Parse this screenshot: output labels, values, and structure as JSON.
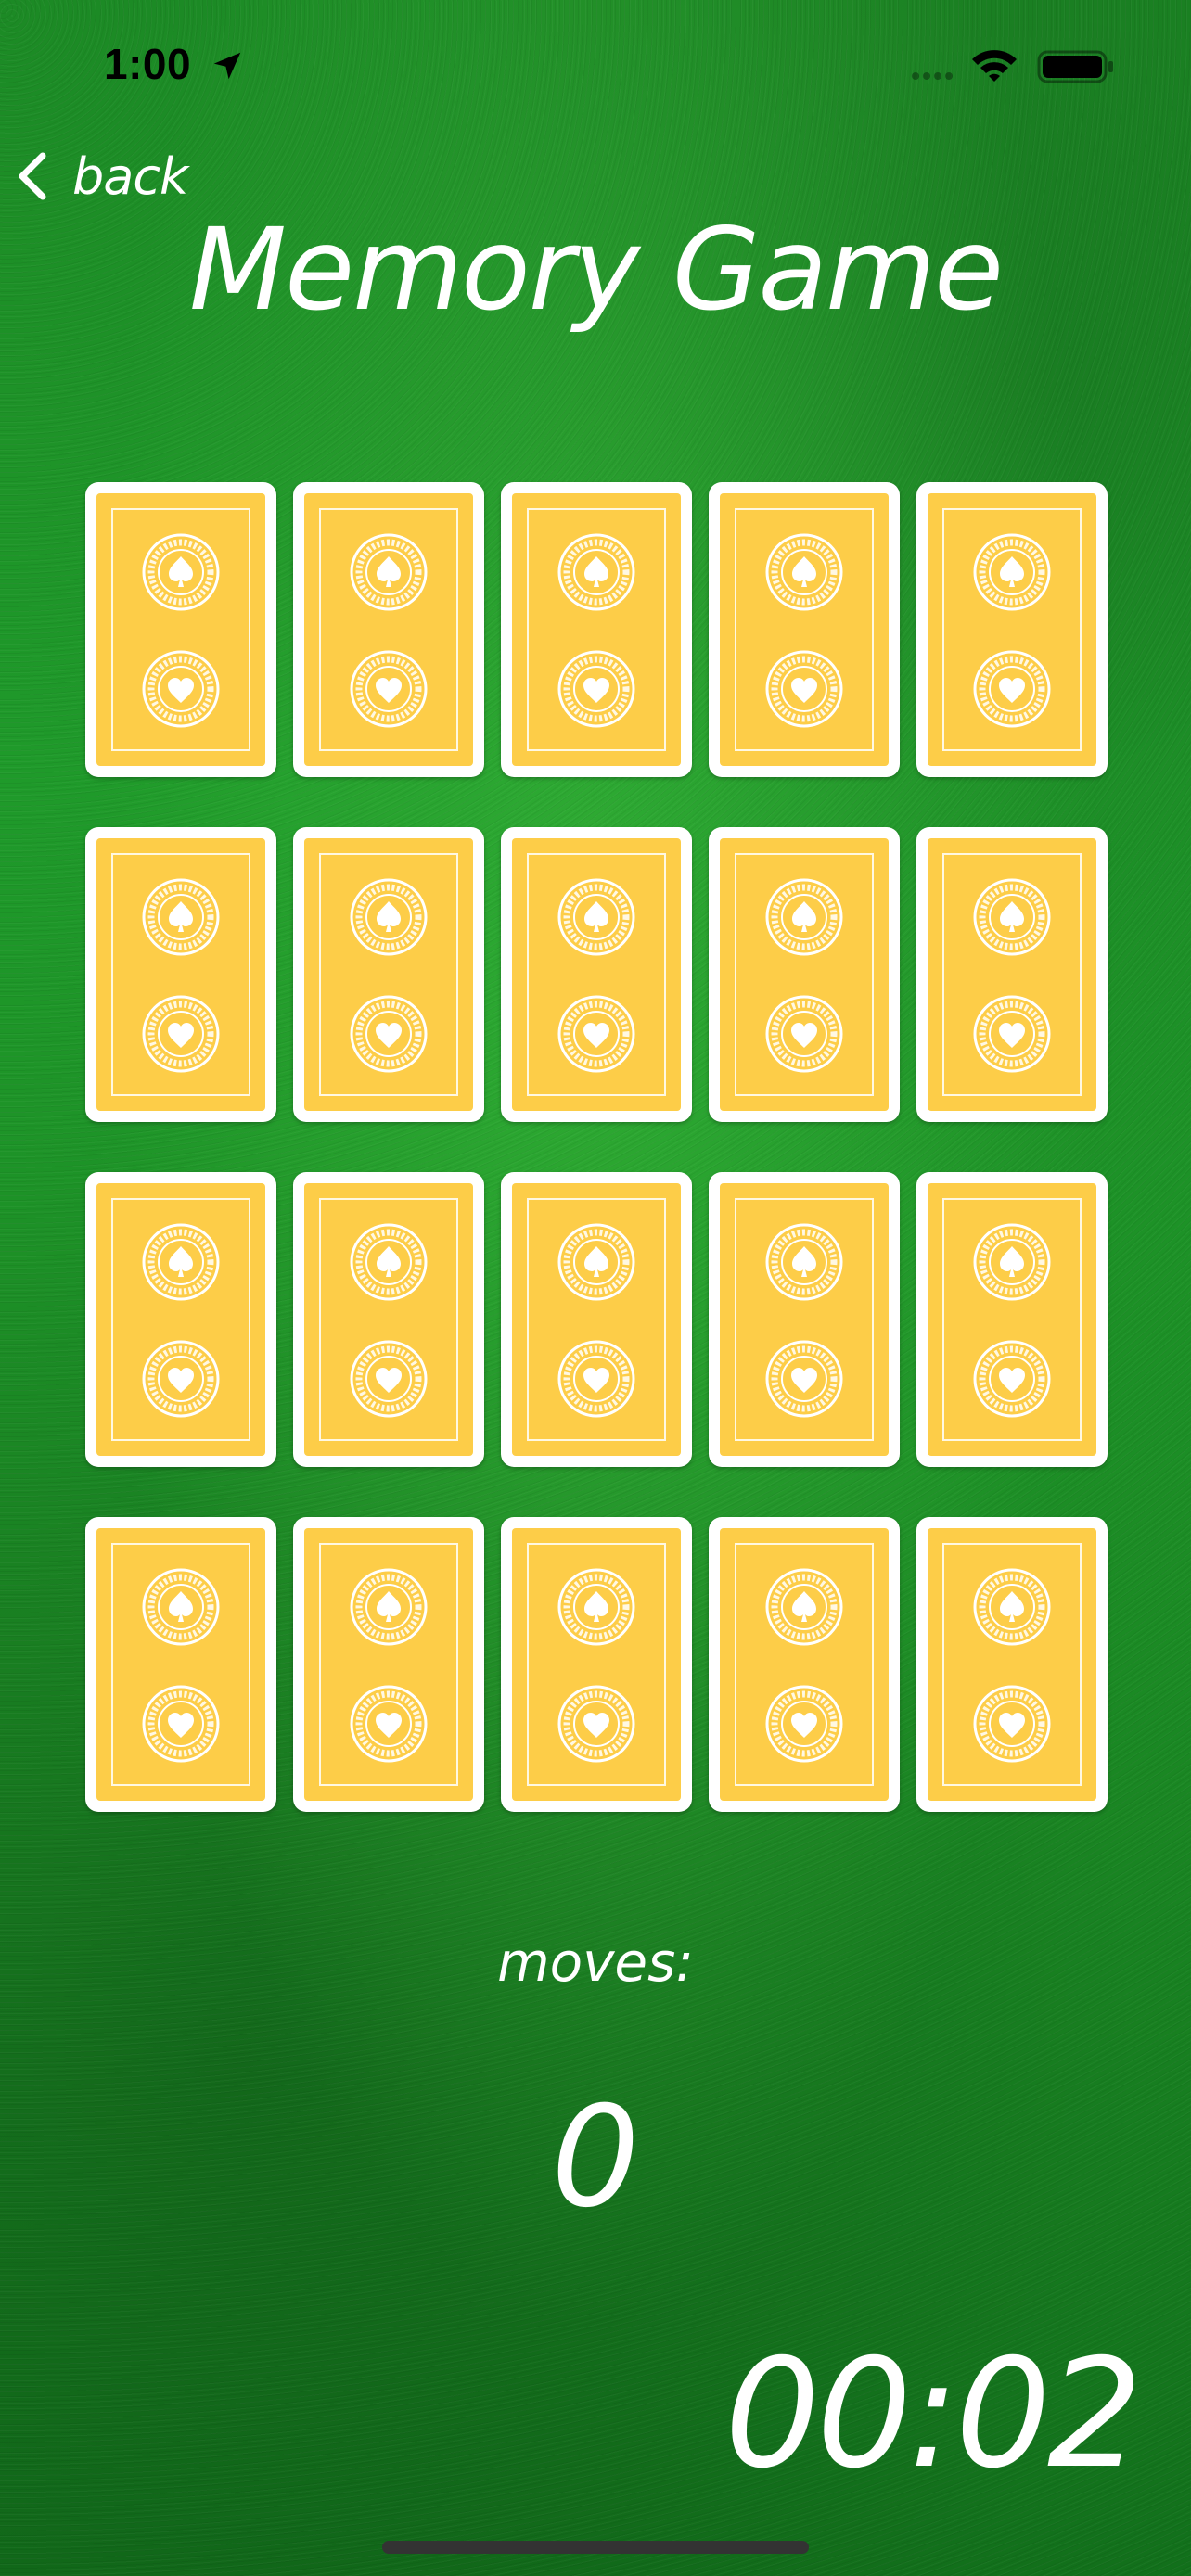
{
  "status_bar": {
    "time": "1:00",
    "icons": [
      "location-arrow-icon",
      "signal-icon",
      "wifi-icon",
      "battery-icon"
    ]
  },
  "nav": {
    "back_label": "back",
    "back_icon": "chevron-left-icon"
  },
  "title": "Memory Game",
  "colors": {
    "felt_green": "#1f9a2a",
    "card_back": "#fdcd48",
    "card_frame": "#ffffff",
    "text": "#ffffff"
  },
  "board": {
    "rows": 4,
    "columns": 5,
    "cards": [
      {
        "state": "face-down"
      },
      {
        "state": "face-down"
      },
      {
        "state": "face-down"
      },
      {
        "state": "face-down"
      },
      {
        "state": "face-down"
      },
      {
        "state": "face-down"
      },
      {
        "state": "face-down"
      },
      {
        "state": "face-down"
      },
      {
        "state": "face-down"
      },
      {
        "state": "face-down"
      },
      {
        "state": "face-down"
      },
      {
        "state": "face-down"
      },
      {
        "state": "face-down"
      },
      {
        "state": "face-down"
      },
      {
        "state": "face-down"
      },
      {
        "state": "face-down"
      },
      {
        "state": "face-down"
      },
      {
        "state": "face-down"
      },
      {
        "state": "face-down"
      },
      {
        "state": "face-down"
      }
    ],
    "card_back_icons": [
      "spade-emblem-icon",
      "heart-emblem-icon"
    ]
  },
  "moves": {
    "label": "moves:",
    "count": "0"
  },
  "timer": "00:02"
}
